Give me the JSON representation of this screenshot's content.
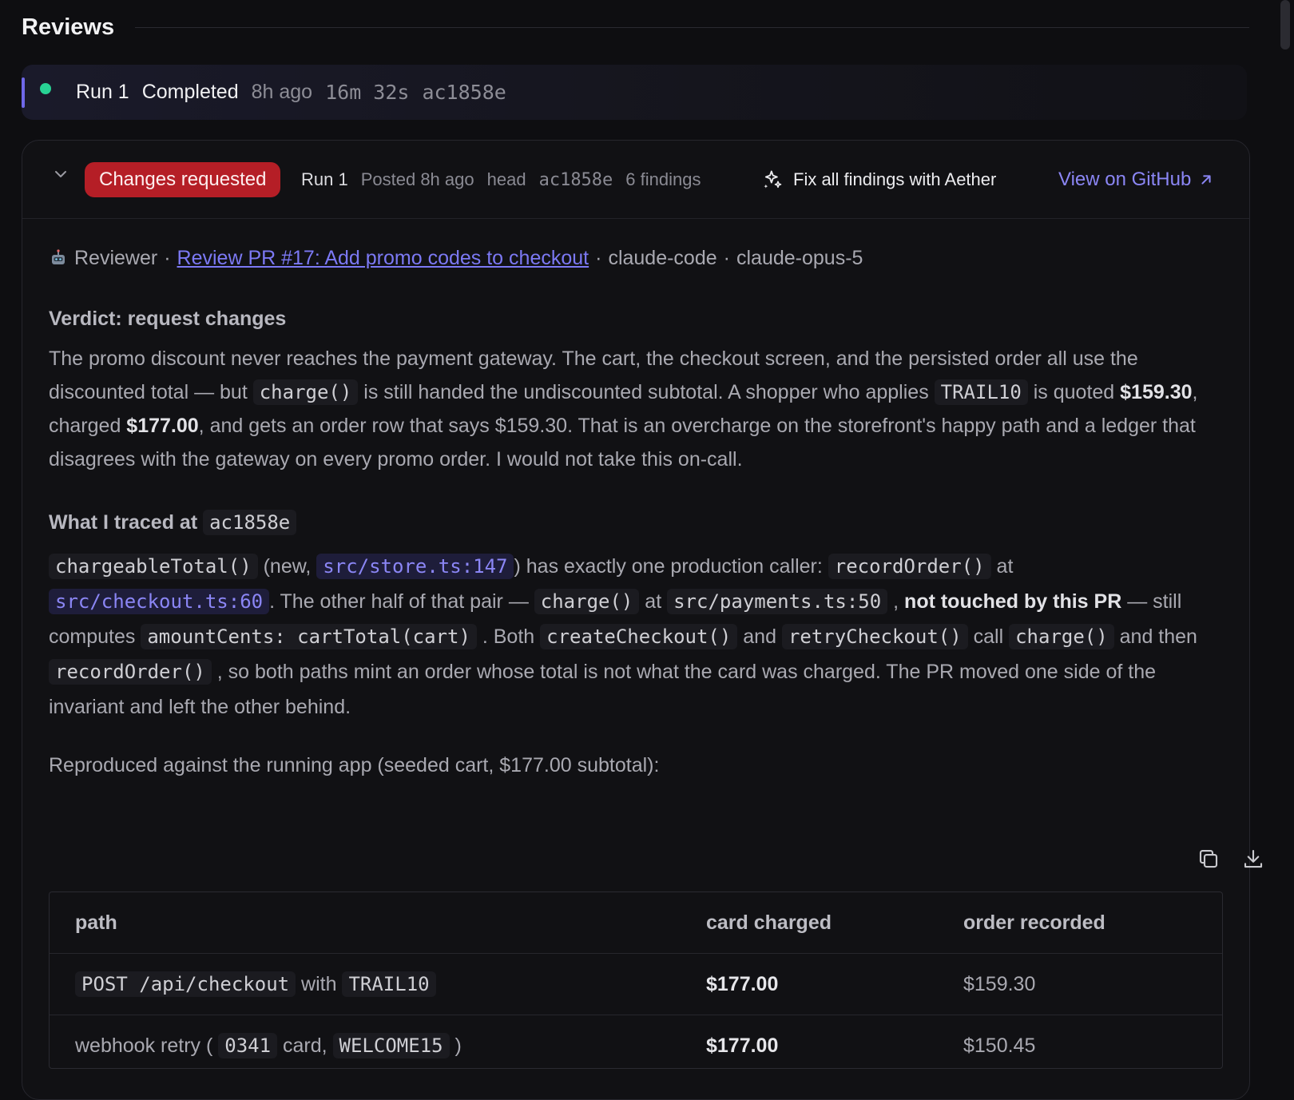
{
  "section": {
    "title": "Reviews"
  },
  "run_bar": {
    "run": "Run 1",
    "status": "Completed",
    "age": "8h ago",
    "duration": "16m 32s",
    "commit": "ac1858e",
    "status_color": "#28d294",
    "accent_color": "#6f68e8"
  },
  "review": {
    "badge": "Changes requested",
    "badge_color": "#b51e26",
    "run": "Run 1",
    "posted": "Posted 8h ago",
    "head_label": "head",
    "head_commit": "ac1858e",
    "findings": "6 findings",
    "fix_button": "Fix all findings with Aether",
    "github_link": "View on GitHub",
    "meta": {
      "role": "Reviewer",
      "sep1": "·",
      "task_link": "Review PR #17: Add promo codes to checkout",
      "sep2": "·",
      "agent": "claude-code",
      "sep3": "·",
      "model": "claude-opus-5"
    },
    "verdict_heading": "Verdict: request changes",
    "verdict": {
      "t1": "The promo discount never reaches the payment gateway. The cart, the checkout screen, and the persisted order all use the discounted total — but ",
      "c1": "charge()",
      "t2": " is still handed the undiscounted subtotal. A shopper who applies ",
      "c2": "TRAIL10",
      "t3": " is quoted ",
      "b1": "$159.30",
      "t4": ", charged ",
      "b2": "$177.00",
      "t5": ", and gets an order row that says $159.30. That is an overcharge on the storefront's happy path and a ledger that disagrees with the gateway on every promo order. I would not take this on-call."
    },
    "traced_heading": "What I traced at",
    "traced_commit": "ac1858e",
    "traced": {
      "c1": "chargeableTotal()",
      "t1": " (new, ",
      "l1": "src/store.ts:147",
      "t2": ") has exactly one production caller: ",
      "c2": "recordOrder()",
      "t3": " at ",
      "l2": "src/checkout.ts:60",
      "t4": ". The other half of that pair — ",
      "c3": "charge()",
      "t5": " at ",
      "c4": "src/payments.ts:50",
      "t6": " , ",
      "b1": "not touched by this PR",
      "t7": " — still computes ",
      "c5": "amountCents: cartTotal(cart)",
      "t8": " . Both ",
      "c6": "createCheckout()",
      "t9": " and ",
      "c7": "retryCheckout()",
      "t10": " call ",
      "c8": "charge()",
      "t11": " and then ",
      "c9": "recordOrder()",
      "t12": " , so both paths mint an order whose total is not what the card was charged. The PR moved one side of the invariant and left the other behind."
    },
    "repro": "Reproduced against the running app (seeded cart, $177.00 subtotal):",
    "table": {
      "headers": [
        "path",
        "card charged",
        "order recorded"
      ],
      "rows": [
        {
          "p_code1": "POST /api/checkout",
          "p_text1": " with ",
          "p_code2": "TRAIL10",
          "charged": "$177.00",
          "recorded": "$159.30"
        },
        {
          "p_text0": "webhook retry ( ",
          "p_code1": "0341",
          "p_text1": " card, ",
          "p_code2": "WELCOME15",
          "p_text2": " )",
          "charged": "$177.00",
          "recorded": "$150.45"
        }
      ]
    }
  }
}
